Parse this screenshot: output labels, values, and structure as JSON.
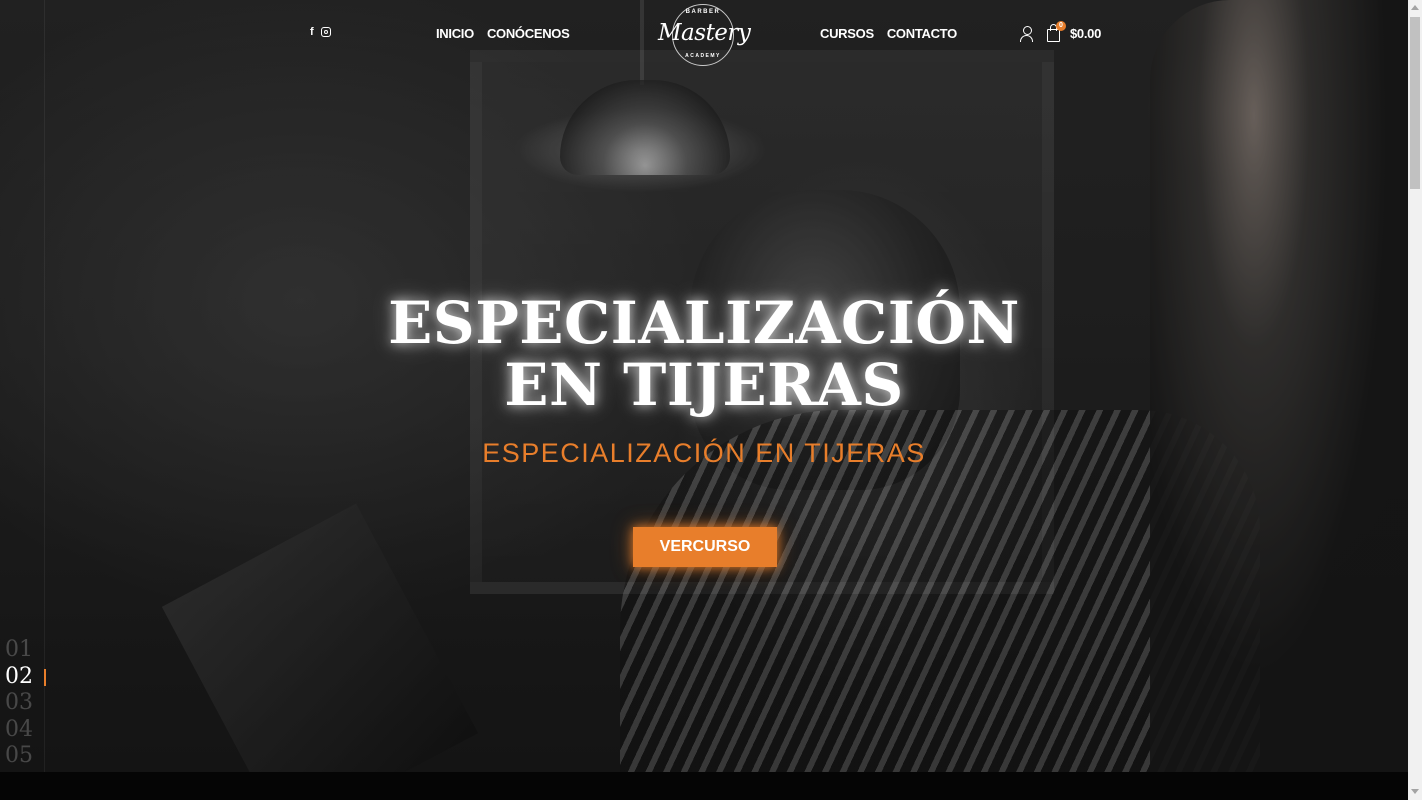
{
  "header": {
    "social": [
      {
        "name": "facebook",
        "glyph": "f"
      },
      {
        "name": "instagram"
      }
    ],
    "nav_left": [
      "INICIO",
      "CONÓCENOS"
    ],
    "nav_right": [
      "CURSOS",
      "CONTACTO"
    ],
    "logo": {
      "top": "BARBER",
      "script": "Mastery",
      "bottom": "ACADEMY"
    },
    "cart": {
      "count": "0",
      "total": "$0.00"
    }
  },
  "hero": {
    "title_line1": "ESPECIALIZACIÓN",
    "title_line2": "EN TIJERAS",
    "subtitle": "ESPECIALIZACIÓN EN TIJERAS",
    "button": "VERCURSO"
  },
  "slider": {
    "items": [
      "01",
      "02",
      "03",
      "04",
      "05"
    ],
    "active_index": 1
  },
  "colors": {
    "accent": "#e87e2b",
    "text": "#ffffff"
  }
}
